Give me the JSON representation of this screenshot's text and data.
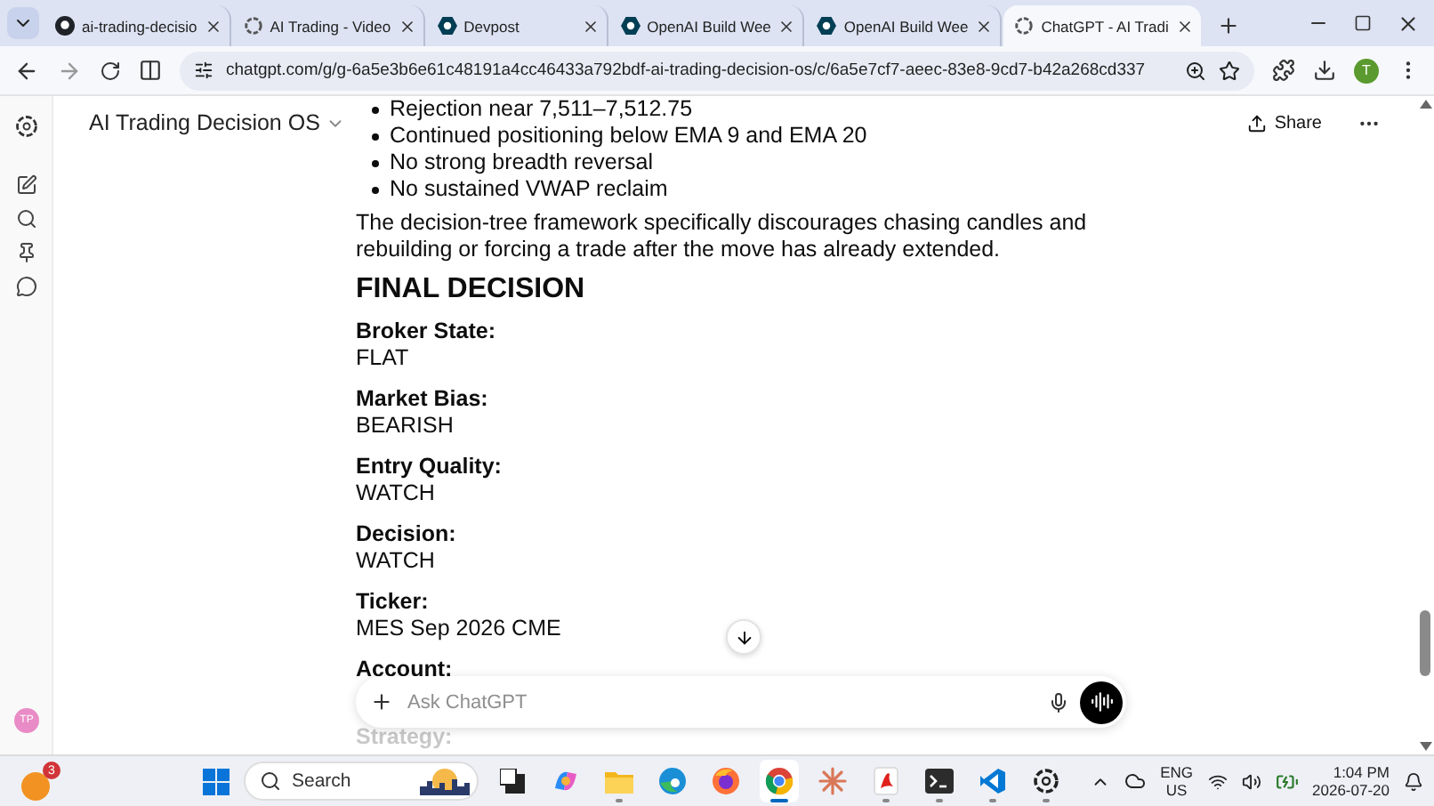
{
  "browser": {
    "tabs": [
      {
        "title": "ai-trading-decisio",
        "kind": "github",
        "selected": false
      },
      {
        "title": "AI Trading - Video",
        "kind": "openai",
        "selected": false
      },
      {
        "title": "Devpost",
        "kind": "devpost",
        "selected": false
      },
      {
        "title": "OpenAI Build Wee",
        "kind": "devpost",
        "selected": false
      },
      {
        "title": "OpenAI Build Wee",
        "kind": "devpost",
        "selected": false
      },
      {
        "title": "ChatGPT - AI Tradi",
        "kind": "openai",
        "selected": true
      }
    ],
    "address": "chatgpt.com/g/g-6a5e3b6e61c48191a4cc46433a792bdf-ai-trading-decision-os/c/6a5e7cf7-aeec-83e8-9cd7-b42a268cd337",
    "profile_initial": "T"
  },
  "sidebar": {
    "avatar": "TP"
  },
  "header": {
    "title": "AI Trading Decision OS",
    "share": "Share"
  },
  "content": {
    "bullets": [
      "Rejection near 7,511–7,512.75",
      "Continued positioning below EMA 9 and EMA 20",
      "No strong breadth reversal",
      "No sustained VWAP reclaim"
    ],
    "paragraph": "The decision-tree framework specifically discourages chasing candles and rebuilding or forcing a trade after the move has already extended.",
    "heading": "FINAL DECISION",
    "fields": [
      {
        "label": "Broker State:",
        "value": "FLAT"
      },
      {
        "label": "Market Bias:",
        "value": "BEARISH"
      },
      {
        "label": "Entry Quality:",
        "value": "WATCH"
      },
      {
        "label": "Decision:",
        "value": "WATCH"
      },
      {
        "label": "Ticker:",
        "value": "MES Sep 2026 CME"
      },
      {
        "label": "Account:"
      }
    ],
    "faded_label": "Strategy:"
  },
  "composer": {
    "placeholder": "Ask ChatGPT"
  },
  "taskbar": {
    "notification_count": "3",
    "search_placeholder": "Search",
    "apps": [
      {
        "kind": "taskview",
        "active": false,
        "running": false
      },
      {
        "kind": "copilot",
        "active": false,
        "running": false
      },
      {
        "kind": "files",
        "active": false,
        "running": true
      },
      {
        "kind": "edge",
        "active": false,
        "running": false
      },
      {
        "kind": "firefox",
        "active": false,
        "running": false
      },
      {
        "kind": "chrome",
        "active": true,
        "running": true
      },
      {
        "kind": "claude",
        "active": false,
        "running": false
      },
      {
        "kind": "acrobat",
        "active": false,
        "running": true
      },
      {
        "kind": "terminal",
        "active": false,
        "running": true
      },
      {
        "kind": "vscode",
        "active": false,
        "running": true
      },
      {
        "kind": "chatgpt",
        "active": false,
        "running": true
      }
    ],
    "language": "ENG",
    "region": "US",
    "time": "1:04 PM",
    "date": "2026-07-20"
  }
}
